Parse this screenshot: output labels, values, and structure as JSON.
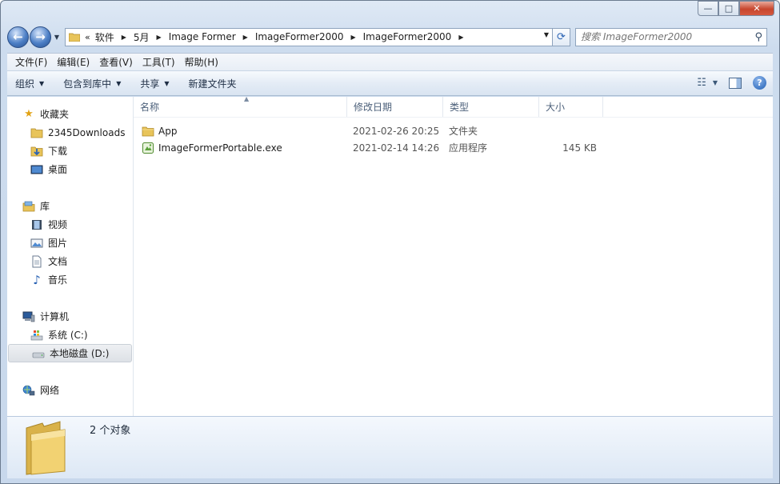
{
  "window": {
    "caption_min": "—",
    "caption_max": "□",
    "caption_close": "✕"
  },
  "address": {
    "overflow": "«",
    "crumbs": [
      "软件",
      "5月",
      "Image Former",
      "ImageFormer2000",
      "ImageFormer2000"
    ]
  },
  "search": {
    "placeholder": "搜索 ImageFormer2000"
  },
  "menu": [
    "文件(F)",
    "编辑(E)",
    "查看(V)",
    "工具(T)",
    "帮助(H)"
  ],
  "commands": {
    "organize": "组织",
    "include_library": "包含到库中",
    "share": "共享",
    "new_folder": "新建文件夹"
  },
  "sidebar": {
    "favorites": "收藏夹",
    "downloads2345": "2345Downloads",
    "downloads": "下载",
    "desktop": "桌面",
    "libraries": "库",
    "videos": "视频",
    "pictures": "图片",
    "documents": "文档",
    "music": "音乐",
    "computer": "计算机",
    "system_c": "系统 (C:)",
    "local_d": "本地磁盘 (D:)",
    "network": "网络"
  },
  "columns": {
    "name": "名称",
    "date": "修改日期",
    "type": "类型",
    "size": "大小"
  },
  "files": [
    {
      "name": "App",
      "date": "2021-02-26 20:25",
      "type": "文件夹",
      "size": "",
      "icon": "folder-icon"
    },
    {
      "name": "ImageFormerPortable.exe",
      "date": "2021-02-14 14:26",
      "type": "应用程序",
      "size": "145 KB",
      "icon": "app-icon"
    }
  ],
  "details": {
    "count": "2 个对象"
  },
  "colors": {
    "accent": "#2b63b4",
    "folder": "#e8c45a"
  }
}
